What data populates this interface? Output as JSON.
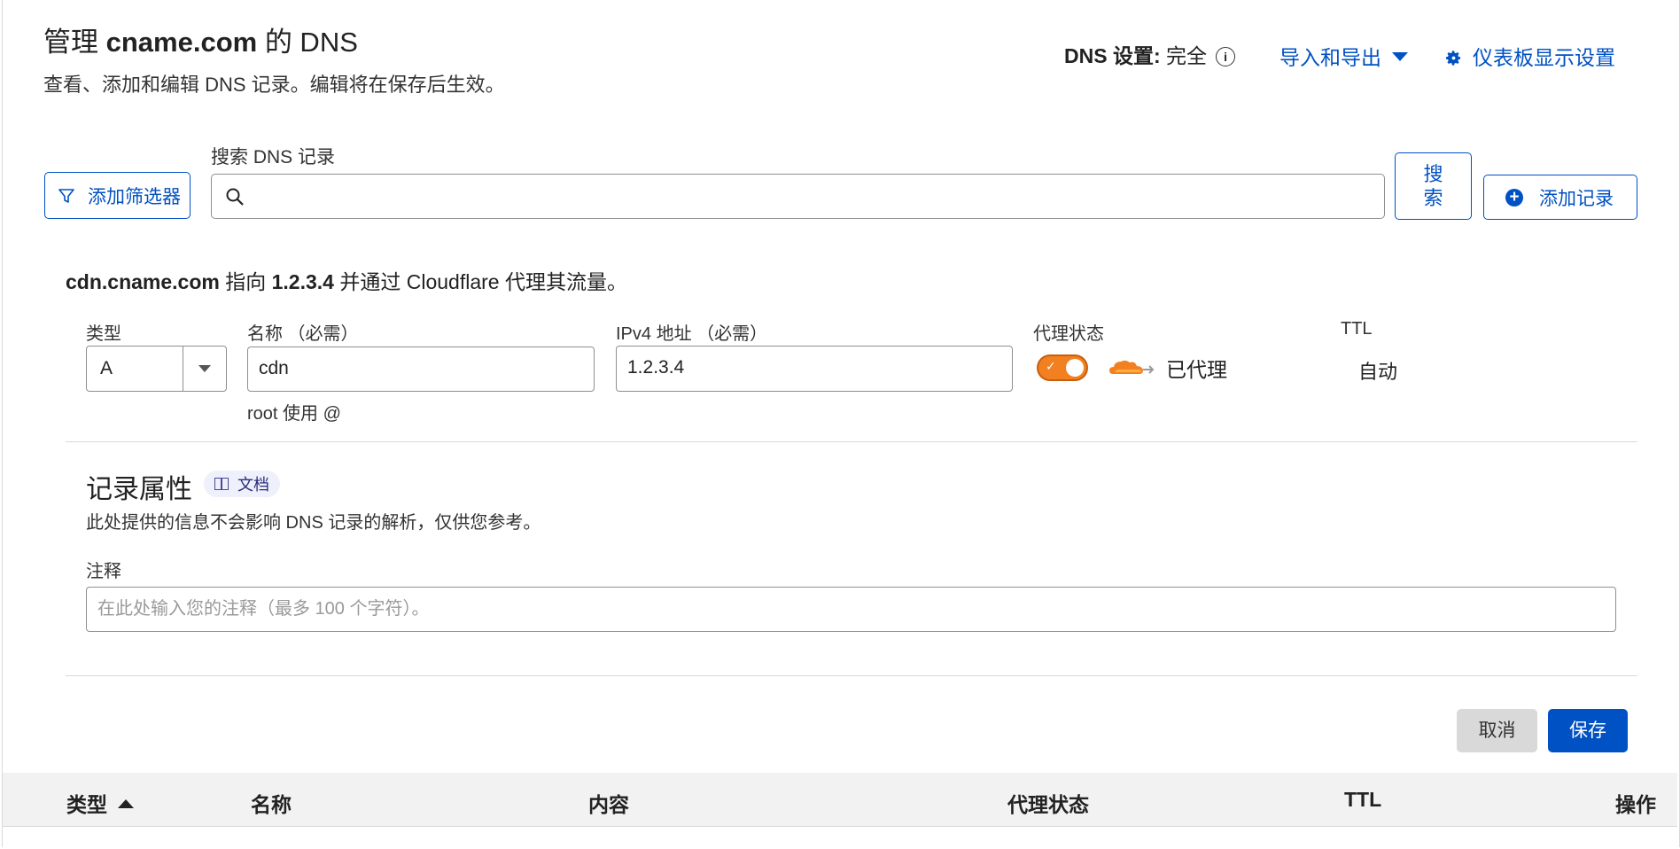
{
  "header": {
    "title_prefix": "管理 ",
    "title_domain": "cname.com",
    "title_suffix": " 的 DNS",
    "subtitle": "查看、添加和编辑 DNS 记录。编辑将在保存后生效。",
    "dns_setting_label": "DNS 设置:",
    "dns_setting_value": "完全",
    "import_export": "导入和导出",
    "dashboard_settings": "仪表板显示设置"
  },
  "toolbar": {
    "add_filter": "添加筛选器",
    "search_label": "搜索 DNS 记录",
    "search_placeholder": "",
    "search_button_line1": "搜",
    "search_button_line2": "索",
    "add_record": "添加记录"
  },
  "record_form": {
    "info_name": "cdn.cname.com",
    "info_points": " 指向 ",
    "info_ip": "1.2.3.4",
    "info_rest": " 并通过 Cloudflare 代理其流量。",
    "type_label": "类型",
    "type_value": "A",
    "name_label": "名称 （必需）",
    "name_value": "cdn",
    "name_hint": "root 使用 @",
    "ipv4_label": "IPv4 地址 （必需）",
    "ipv4_value": "1.2.3.4",
    "proxy_label": "代理状态",
    "proxy_status": "已代理",
    "proxy_enabled": true,
    "ttl_label": "TTL",
    "ttl_value": "自动"
  },
  "attributes": {
    "title": "记录属性",
    "doc_badge": "文档",
    "description": "此处提供的信息不会影响 DNS 记录的解析，仅供您参考。",
    "note_label": "注释",
    "note_placeholder": "在此处输入您的注释（最多 100 个字符）。"
  },
  "actions": {
    "cancel": "取消",
    "save": "保存"
  },
  "table": {
    "headers": [
      "类型",
      "名称",
      "内容",
      "代理状态",
      "TTL",
      "操作"
    ]
  },
  "colors": {
    "accent": "#0051c3",
    "proxy_orange": "#f38020"
  }
}
